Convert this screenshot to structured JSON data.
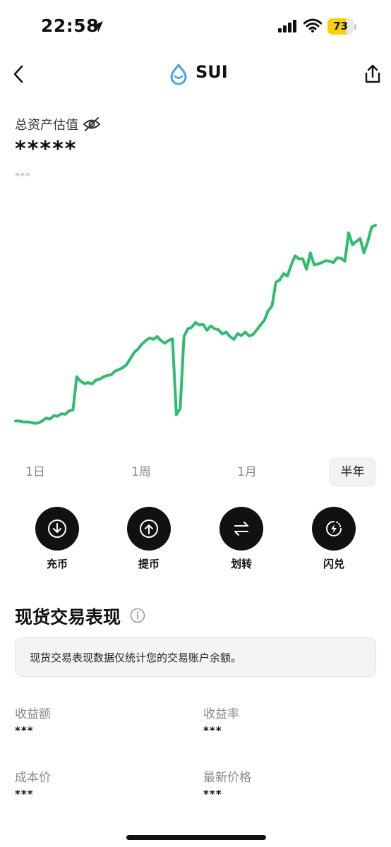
{
  "status_bar": {
    "time": "22:58",
    "battery_level": "73",
    "battery_fraction": 0.73,
    "battery_color": "#f8d100"
  },
  "nav": {
    "title": "SUI",
    "logo_color": "#4aa1f0",
    "back_icon": "chevron-left-icon",
    "share_icon": "share-icon"
  },
  "asset": {
    "label": "总资产估值",
    "value": "*****",
    "sub_value": "***",
    "visibility_icon": "eye-off-icon"
  },
  "chart_data": {
    "type": "line",
    "color": "#2dbd6e",
    "title": "",
    "xlabel": "",
    "ylabel": "",
    "grid": false,
    "legend": "none",
    "y_values_note_hidden": true,
    "points": [
      [
        0,
        0.04
      ],
      [
        1,
        0.04
      ],
      [
        2,
        0.036
      ],
      [
        3,
        0.036
      ],
      [
        4,
        0.034
      ],
      [
        5,
        0.03
      ],
      [
        6,
        0.032
      ],
      [
        7,
        0.04
      ],
      [
        8,
        0.052
      ],
      [
        9,
        0.048
      ],
      [
        10,
        0.062
      ],
      [
        11,
        0.06
      ],
      [
        12,
        0.07
      ],
      [
        13,
        0.068
      ],
      [
        14,
        0.082
      ],
      [
        15,
        0.086
      ],
      [
        16,
        0.224
      ],
      [
        17,
        0.206
      ],
      [
        18,
        0.196
      ],
      [
        19,
        0.2
      ],
      [
        20,
        0.194
      ],
      [
        21,
        0.21
      ],
      [
        22,
        0.214
      ],
      [
        23,
        0.224
      ],
      [
        24,
        0.23
      ],
      [
        25,
        0.232
      ],
      [
        26,
        0.248
      ],
      [
        27,
        0.254
      ],
      [
        28,
        0.262
      ],
      [
        29,
        0.274
      ],
      [
        30,
        0.3
      ],
      [
        31,
        0.326
      ],
      [
        32,
        0.34
      ],
      [
        33,
        0.36
      ],
      [
        34,
        0.374
      ],
      [
        35,
        0.386
      ],
      [
        36,
        0.38
      ],
      [
        37,
        0.392
      ],
      [
        38,
        0.374
      ],
      [
        39,
        0.364
      ],
      [
        40,
        0.376
      ],
      [
        41,
        0.382
      ],
      [
        42,
        0.066
      ],
      [
        43,
        0.092
      ],
      [
        44,
        0.392
      ],
      [
        45,
        0.424
      ],
      [
        46,
        0.43
      ],
      [
        47,
        0.45
      ],
      [
        48,
        0.44
      ],
      [
        49,
        0.442
      ],
      [
        50,
        0.418
      ],
      [
        51,
        0.436
      ],
      [
        52,
        0.424
      ],
      [
        53,
        0.42
      ],
      [
        54,
        0.402
      ],
      [
        55,
        0.41
      ],
      [
        56,
        0.392
      ],
      [
        57,
        0.38
      ],
      [
        58,
        0.404
      ],
      [
        59,
        0.396
      ],
      [
        60,
        0.41
      ],
      [
        61,
        0.394
      ],
      [
        62,
        0.4
      ],
      [
        63,
        0.42
      ],
      [
        64,
        0.44
      ],
      [
        65,
        0.46
      ],
      [
        66,
        0.5
      ],
      [
        67,
        0.52
      ],
      [
        68,
        0.618
      ],
      [
        69,
        0.628
      ],
      [
        70,
        0.654
      ],
      [
        71,
        0.644
      ],
      [
        72,
        0.69
      ],
      [
        73,
        0.728
      ],
      [
        74,
        0.716
      ],
      [
        75,
        0.716
      ],
      [
        76,
        0.672
      ],
      [
        77,
        0.74
      ],
      [
        78,
        0.69
      ],
      [
        79,
        0.694
      ],
      [
        80,
        0.7
      ],
      [
        81,
        0.708
      ],
      [
        82,
        0.706
      ],
      [
        83,
        0.7
      ],
      [
        84,
        0.72
      ],
      [
        85,
        0.718
      ],
      [
        86,
        0.706
      ],
      [
        87,
        0.824
      ],
      [
        88,
        0.774
      ],
      [
        89,
        0.788
      ],
      [
        90,
        0.8
      ],
      [
        91,
        0.74
      ],
      [
        92,
        0.788
      ],
      [
        93,
        0.848
      ],
      [
        94,
        0.856
      ]
    ]
  },
  "range_tabs": [
    {
      "label": "1日",
      "active": false
    },
    {
      "label": "1周",
      "active": false
    },
    {
      "label": "1月",
      "active": false
    },
    {
      "label": "半年",
      "active": true
    }
  ],
  "actions": [
    {
      "label": "充币",
      "icon": "deposit-icon"
    },
    {
      "label": "提币",
      "icon": "withdraw-icon"
    },
    {
      "label": "划转",
      "icon": "transfer-icon"
    },
    {
      "label": "闪兑",
      "icon": "flash-swap-icon"
    }
  ],
  "performance": {
    "title": "现货交易表现",
    "info_icon": "info-icon",
    "notice": "现货交易表现数据仅统计您的交易账户余额。",
    "stats": [
      {
        "label": "收益额",
        "value": "***"
      },
      {
        "label": "收益率",
        "value": "***"
      },
      {
        "label": "成本价",
        "value": "***"
      },
      {
        "label": "最新价格",
        "value": "***"
      }
    ]
  }
}
